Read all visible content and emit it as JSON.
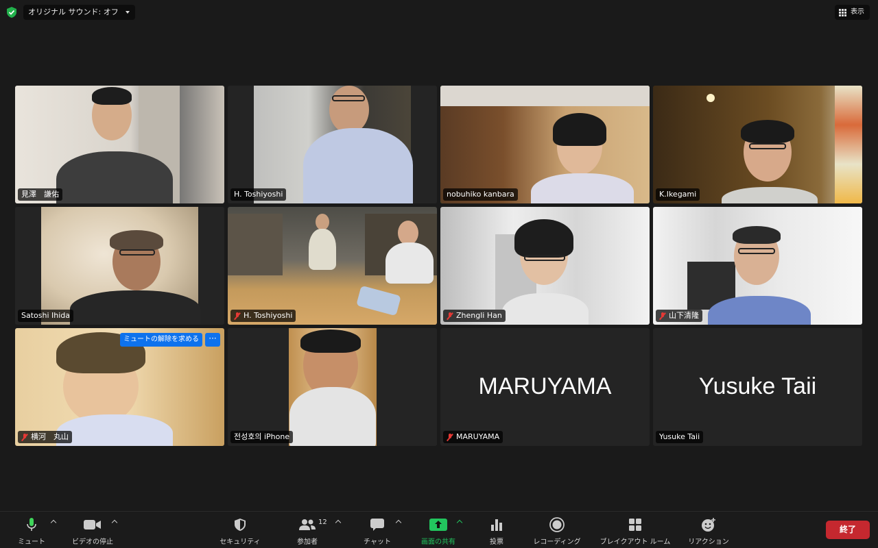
{
  "top_bar": {
    "sound_dropdown": "オリジナル サウンド: オフ",
    "view_label": "表示"
  },
  "participants": [
    {
      "name": "見澤　謙佑",
      "muted": false,
      "video": true,
      "active_speaker": false
    },
    {
      "name": "H. Toshiyoshi",
      "muted": false,
      "video": true,
      "active_speaker": false
    },
    {
      "name": "nobuhiko kanbara",
      "muted": false,
      "video": true,
      "active_speaker": true
    },
    {
      "name": "K.Ikegami",
      "muted": false,
      "video": true,
      "active_speaker": false
    },
    {
      "name": "Satoshi Ihida",
      "muted": false,
      "video": true,
      "active_speaker": false
    },
    {
      "name": "H. Toshiyoshi",
      "muted": true,
      "video": true,
      "active_speaker": false
    },
    {
      "name": "Zhengli Han",
      "muted": true,
      "video": true,
      "active_speaker": false
    },
    {
      "name": "山下清隆",
      "muted": true,
      "video": true,
      "active_speaker": false
    },
    {
      "name": "横河　丸山",
      "muted": true,
      "video": true,
      "active_speaker": false,
      "unmute_request_label": "ミュートの解除を求める",
      "more_label": "···"
    },
    {
      "name": "전성호의 iPhone",
      "muted": false,
      "video": true,
      "active_speaker": false
    },
    {
      "name": "MARUYAMA",
      "display_name": "MARUYAMA",
      "muted": true,
      "video": false,
      "active_speaker": false
    },
    {
      "name": "Yusuke Taii",
      "display_name": "Yusuke Taii",
      "muted": false,
      "video": false,
      "active_speaker": false
    }
  ],
  "toolbar": {
    "mute": "ミュート",
    "stop_video": "ビデオの停止",
    "security": "セキュリティ",
    "participants": "参加者",
    "participants_count": "12",
    "chat": "チャット",
    "share_screen": "画面の共有",
    "polls": "投票",
    "recording": "レコーディング",
    "breakout_rooms": "ブレイクアウト ルーム",
    "reactions": "リアクション",
    "end": "終了"
  },
  "colors": {
    "active_speaker_border": "#2ecc40",
    "share_green": "#22c55e",
    "end_red": "#c5282f",
    "unmute_blue": "#0e72ed",
    "muted_red": "#e53935"
  }
}
